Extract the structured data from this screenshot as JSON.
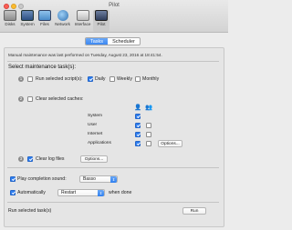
{
  "window": {
    "title": "Pilot"
  },
  "toolbar": {
    "items": [
      {
        "label": "Disks",
        "icon": "disks-icon"
      },
      {
        "label": "System",
        "icon": "system-icon"
      },
      {
        "label": "Files",
        "icon": "files-icon"
      },
      {
        "label": "Network",
        "icon": "network-icon"
      },
      {
        "label": "Interface",
        "icon": "interface-icon"
      },
      {
        "label": "Pilot",
        "icon": "pilot-icon",
        "selected": true
      }
    ]
  },
  "tabs": [
    {
      "label": "Tasks",
      "active": true
    },
    {
      "label": "Scheduler",
      "active": false
    }
  ],
  "main": {
    "last_run_note": "Manual maintenance was last performed on Tuesday, August 23, 2016 at 18:41:54.",
    "section_title": "Select maintenance task(s):",
    "task1": {
      "number": "1",
      "label": "Run selected script(s):",
      "checked": false,
      "options": [
        {
          "label": "Daily",
          "checked": true
        },
        {
          "label": "Weekly",
          "checked": false
        },
        {
          "label": "Monthly",
          "checked": false
        }
      ]
    },
    "task2": {
      "number": "2",
      "label": "Clear selected caches:",
      "checked": false,
      "columns": [
        {
          "icon": "user-icon",
          "glyph": "👤"
        },
        {
          "icon": "users-icon",
          "glyph": "👥"
        }
      ],
      "caches": [
        {
          "label": "System",
          "col1": true,
          "col2": null
        },
        {
          "label": "User",
          "col1": true,
          "col2": false
        },
        {
          "label": "Internet",
          "col1": true,
          "col2": false
        },
        {
          "label": "Applications",
          "col1": true,
          "col2": false
        }
      ],
      "options_label": "Options..."
    },
    "task3": {
      "number": "3",
      "label": "Clear log files",
      "checked": true,
      "options_label": "Options..."
    },
    "completion_sound": {
      "label": "Play completion sound:",
      "checked": true,
      "value": "Basso"
    },
    "auto_action": {
      "label": "Automatically",
      "checked": true,
      "value": "Restart",
      "suffix": "when done"
    },
    "run": {
      "label": "Run selected task(s)",
      "button": "Run"
    }
  },
  "colors": {
    "accent": "#2f7ff0",
    "close": "#fc5f57",
    "minimize": "#fdbc2e"
  }
}
